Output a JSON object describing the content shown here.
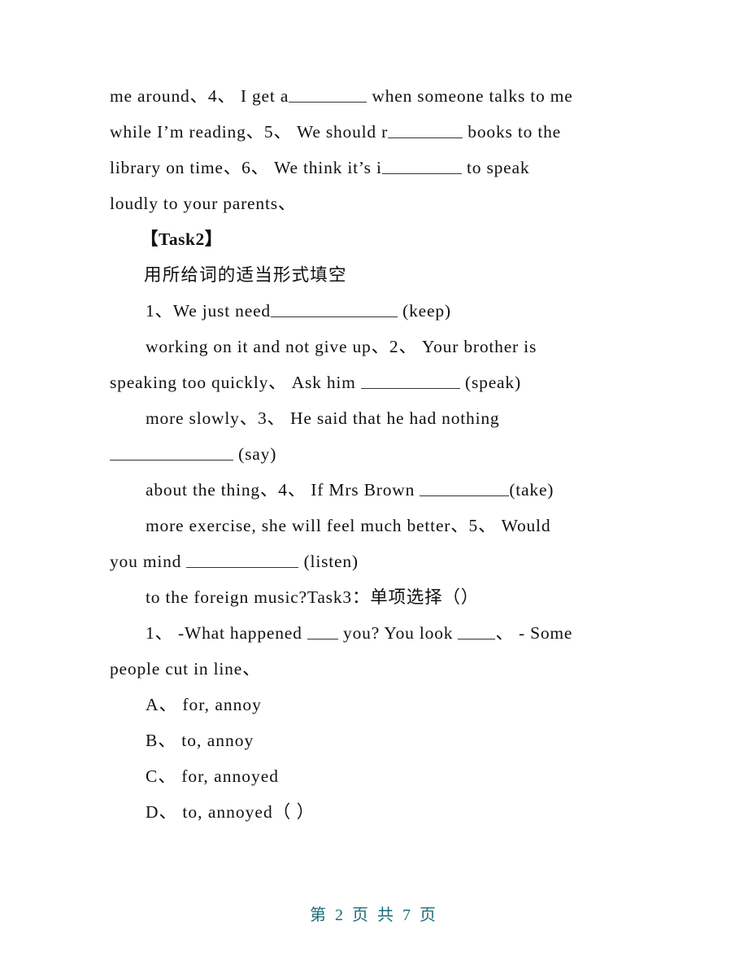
{
  "document": {
    "type": "worksheet",
    "page_label": "第 2 页 共 7 页",
    "footer_color": "#1d6c77",
    "background_color": "#ffffff",
    "text_color": "#111111"
  },
  "body": {
    "para_task1_tail": {
      "l1": "me around、4、 I get a",
      "l1b": " when someone talks to me",
      "l2": "while I’m reading、5、 We should r",
      "l2b": " books to the",
      "l3": "library on time、6、 We think it’s i",
      "l3b": " to speak",
      "l4": "loudly to your parents、"
    },
    "task2": {
      "heading": "【Task2】",
      "instruction": "用所给词的适当形式填空",
      "q1_a": "1、We just need",
      "q1_b": " (keep)",
      "q1_cont": "working on it and not give up、2、 Your brother is",
      "q2_a": "speaking too quickly、 Ask him ",
      "q2_b": " (speak)",
      "q2_cont": "more slowly、3、 He said that he had nothing",
      "q3_b": " (say)",
      "q3_cont": "about the thing、4、 If Mrs Brown ",
      "q4_b": "(take)",
      "q4_cont": "more exercise, she will feel much better、5、 Would",
      "q5_a": "you mind ",
      "q5_b": " (listen)",
      "q5_cont": "to the foreign music?Task3：单项选择（）"
    },
    "task3": {
      "q1_line1": "1、 -What happened ",
      "q1_line1b": " you? You look ",
      "q1_line1c": "、 - Some",
      "q1_line2": "people cut in line、",
      "options": [
        "A、 for, annoy",
        "B、 to, annoy",
        "C、 for, annoyed",
        "D、 to, annoyed（ ）"
      ]
    }
  }
}
